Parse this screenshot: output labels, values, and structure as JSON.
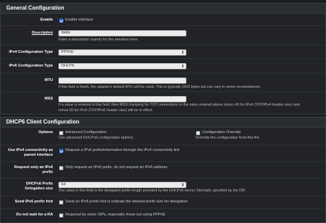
{
  "general": {
    "title": "General Configuration",
    "enable_label": "Enable",
    "enable_text": "Enable interface",
    "description_label": "Description",
    "description_value": "WAN",
    "description_help": "Enter a description (name) for the interface here.",
    "ipv4_label": "IPv4 Configuration Type",
    "ipv4_value": "PPPoE",
    "ipv6_label": "IPv6 Configuration Type",
    "ipv6_value": "DHCP6",
    "mtu_label": "MTU",
    "mtu_value": "",
    "mtu_help": "If this field is blank, the adapter's default MTU will be used. This is typically 1500 bytes but can vary in some circumstances.",
    "mss_label": "MSS",
    "mss_value": "",
    "mss_help_1": "If a value is entered in this field, then MSS clamping for TCP connections to the value entered above minus 40 for IPv4 (TCP/IPv4 header size) and",
    "mss_help_2": "minus 60 for IPv6 (TCP/IPv6 header size) will be in effect."
  },
  "dhcp6": {
    "title": "DHCP6 Client Configuration",
    "options_label": "Options",
    "adv_config_text": "Advanced Configuration",
    "adv_config_help": "Use advanced DHCPv6 configuration options.",
    "config_override_text": "Configuration Override",
    "config_override_help": "Override the configuration from this file.",
    "use_ipv4_label_1": "Use IPv4 connectivity as",
    "use_ipv4_label_2": "parent interface",
    "use_ipv4_text": "Request a IPv6 prefix/information through the IPv4 connectivity link",
    "only_ipv6_label_1": "Request only an IPv6",
    "only_ipv6_label_2": "prefix",
    "only_ipv6_text": "Only request an IPv6 prefix, do not request an IPv6 address",
    "prefix_label_1": "DHCPv6 Prefix",
    "prefix_label_2": "Delegation size",
    "prefix_value": "64",
    "prefix_help": "The value in this field is the delegated prefix length provided by the DHCPv6 server. Normally specified by the ISP.",
    "hint_label": "Send IPv6 prefix hint",
    "hint_text": "Send an IPv6 prefix hint to indicate the desired prefix size for delegation",
    "ra_label": "Do not wait for a RA",
    "ra_text": "Required by some ISPs, especially those not using PPPoE"
  }
}
